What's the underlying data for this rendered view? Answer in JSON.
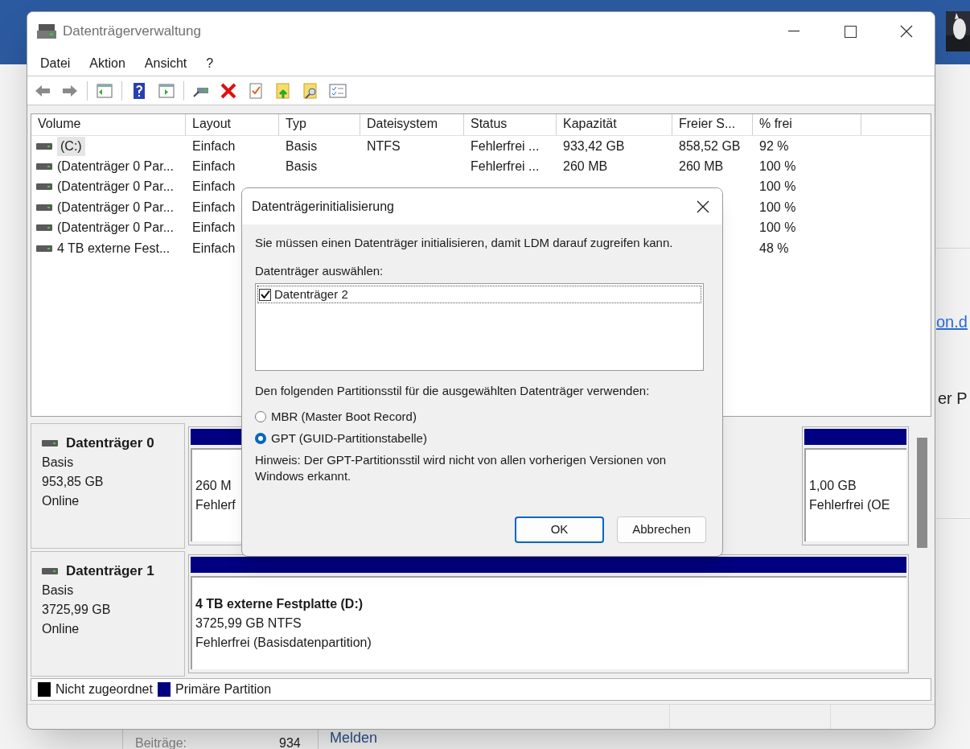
{
  "background_page": {
    "link_fragment": "on.d",
    "text_fragment": "er P",
    "stats_label": "Beiträge:",
    "stats_value": "934",
    "report_link": "Melden"
  },
  "window": {
    "title": "Datenträgerverwaltung"
  },
  "menu": [
    "Datei",
    "Aktion",
    "Ansicht",
    "?"
  ],
  "volume_table": {
    "columns": [
      "Volume",
      "Layout",
      "Typ",
      "Dateisystem",
      "Status",
      "Kapazität",
      "Freier S...",
      "% frei"
    ],
    "rows": [
      {
        "volume": "(C:)",
        "layout": "Einfach",
        "type": "Basis",
        "file_system": "NTFS",
        "status": "Fehlerfrei ...",
        "capacity": "933,42 GB",
        "free_space": "858,52 GB",
        "percent_free": "92 %",
        "selected": true
      },
      {
        "volume": "(Datenträger 0 Par...",
        "layout": "Einfach",
        "type": "Basis",
        "status": "Fehlerfrei ...",
        "capacity": "260 MB",
        "free_space": "260 MB",
        "percent_free": "100 %",
        "selected": false
      },
      {
        "volume": "(Datenträger 0 Par...",
        "layout": "Einfach",
        "percent_free": "100 %",
        "selected": false
      },
      {
        "volume": "(Datenträger 0 Par...",
        "layout": "Einfach",
        "percent_free": "100 %",
        "selected": false
      },
      {
        "volume": "(Datenträger 0 Par...",
        "layout": "Einfach",
        "percent_free": "100 %",
        "selected": false
      },
      {
        "volume": "4 TB externe Fest...",
        "layout": "Einfach",
        "percent_free": "48 %",
        "selected": false
      }
    ]
  },
  "disks": [
    {
      "name": "Datenträger 0",
      "type": "Basis",
      "size": "953,85 GB",
      "state": "Online",
      "partitions": [
        {
          "kind": "primary",
          "lines": [
            "260 M",
            "Fehlerf"
          ]
        },
        {
          "kind": "primary",
          "lines": [
            "1,00 GB",
            "Fehlerfrei (OE"
          ]
        }
      ]
    },
    {
      "name": "Datenträger 1",
      "type": "Basis",
      "size": "3725,99 GB",
      "state": "Online",
      "partitions": [
        {
          "kind": "primary",
          "title": "4 TB externe Festplatte  (D:)",
          "lines": [
            "3725,99 GB NTFS",
            "Fehlerfrei (Basisdatenpartition)"
          ]
        }
      ]
    }
  ],
  "legend": [
    {
      "label": "Nicht zugeordnet",
      "color": "#000000"
    },
    {
      "label": "Primäre Partition",
      "color": "#000080"
    }
  ],
  "init_dialog": {
    "title": "Datenträgerinitialisierung",
    "message": "Sie müssen einen Datenträger initialisieren, damit LDM darauf zugreifen kann.",
    "select_label": "Datenträger auswählen:",
    "disks": [
      {
        "label": "Datenträger 2",
        "checked": true,
        "selected": true
      }
    ],
    "style_label": "Den folgenden Partitionsstil für die ausgewählten Datenträger verwenden:",
    "styles": [
      {
        "label": "MBR (Master Boot Record)",
        "selected": false
      },
      {
        "label": "GPT (GUID-Partitionstabelle)",
        "selected": true
      }
    ],
    "hint": "Hinweis: Der GPT-Partitionsstil wird nicht von allen vorherigen Versionen von Windows erkannt.",
    "buttons": [
      {
        "label": "OK",
        "default": true
      },
      {
        "label": "Abbrechen",
        "default": false
      }
    ]
  }
}
